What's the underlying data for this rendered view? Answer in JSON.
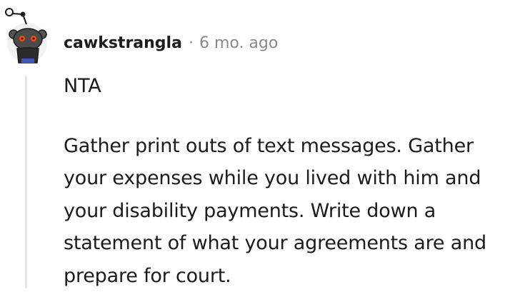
{
  "comment": {
    "username": "cawkstrangla",
    "separator": "·",
    "timestamp": "6 mo. ago",
    "paragraphs": [
      "NTA",
      "Gather print outs of text messages. Gather your expenses while you lived with him and your disability payments. Write down a statement of what your agreements are and prepare for court."
    ]
  },
  "avatar": {
    "icon": "reddit-snoo-avatar-icon",
    "body_color": "#3a3a3a",
    "eye_color": "#ff4500",
    "background_color": "#f6f7f8"
  }
}
